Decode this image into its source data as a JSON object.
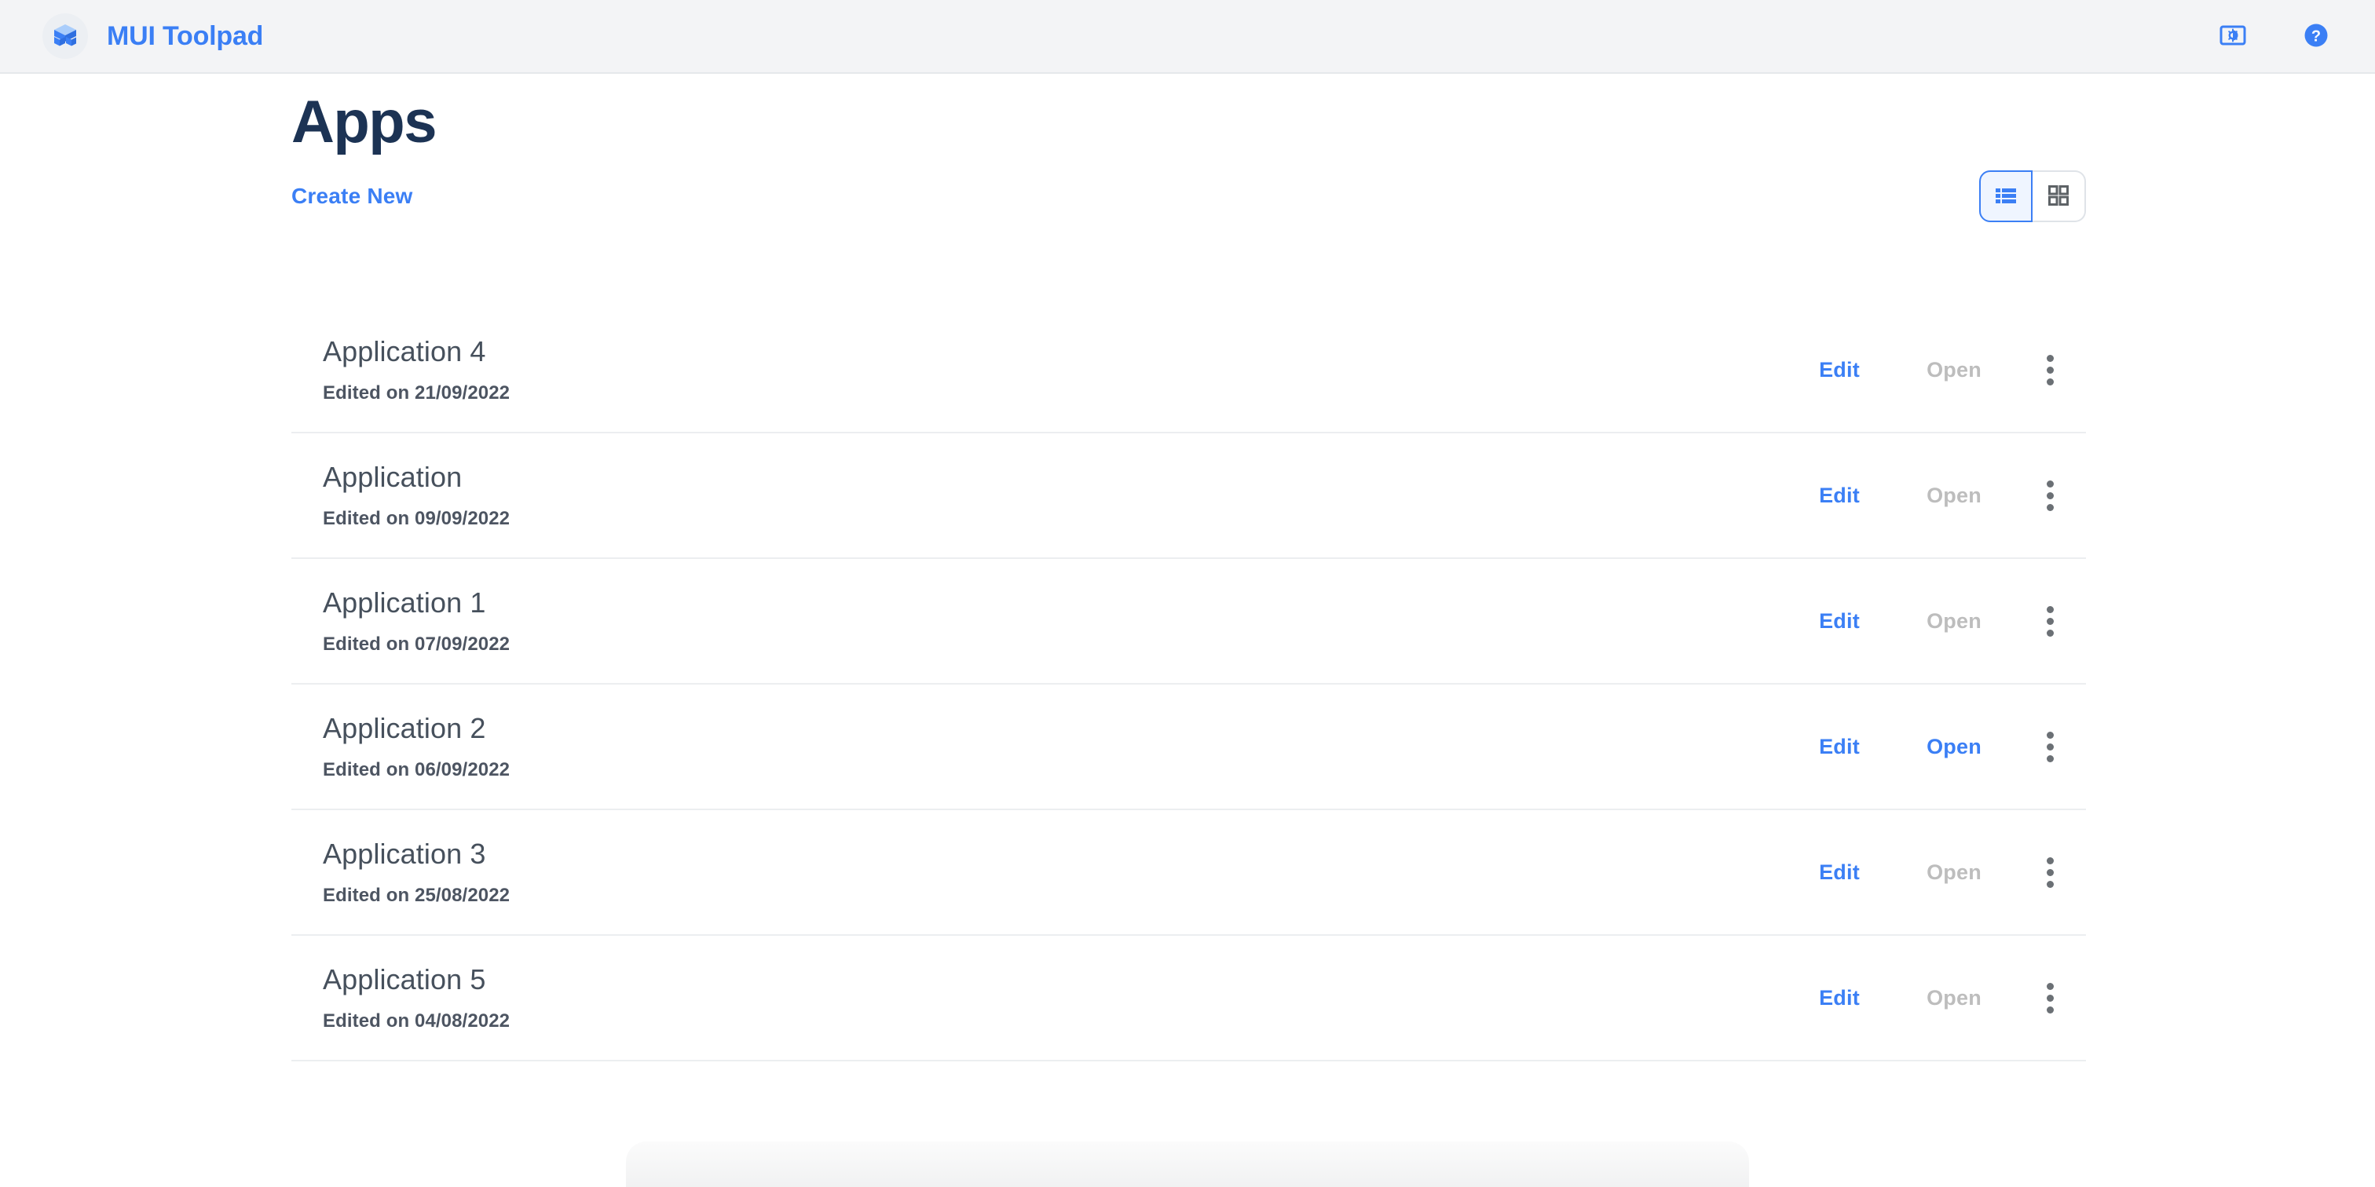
{
  "appbar": {
    "logo_icon": "toolpad-blocks-logo-icon",
    "brand": "MUI Toolpad",
    "actions": [
      {
        "icon": "brightness-theme-icon",
        "label": "Toggle theme"
      },
      {
        "icon": "help-circle-icon",
        "label": "Help"
      }
    ]
  },
  "page": {
    "title": "Apps",
    "create_new_label": "Create New"
  },
  "view_toggle": {
    "options": [
      {
        "icon": "list-view-icon",
        "label": "List view",
        "active": true
      },
      {
        "icon": "grid-view-icon",
        "label": "Grid view",
        "active": false
      }
    ]
  },
  "row_actions": {
    "edit_label": "Edit",
    "open_label": "Open",
    "more_icon": "more-vertical-icon"
  },
  "apps": [
    {
      "name": "Application 4",
      "edited": "Edited on 21/09/2022",
      "open_enabled": false
    },
    {
      "name": "Application",
      "edited": "Edited on 09/09/2022",
      "open_enabled": false
    },
    {
      "name": "Application 1",
      "edited": "Edited on 07/09/2022",
      "open_enabled": false
    },
    {
      "name": "Application 2",
      "edited": "Edited on 06/09/2022",
      "open_enabled": true
    },
    {
      "name": "Application 3",
      "edited": "Edited on 25/08/2022",
      "open_enabled": false
    },
    {
      "name": "Application 5",
      "edited": "Edited on 04/08/2022",
      "open_enabled": false
    }
  ],
  "colors": {
    "brand_blue": "#3b7ff5",
    "title_navy": "#1c3354",
    "text_gray": "#46505c",
    "disabled_gray": "#bdbdbd",
    "appbar_bg": "#f3f4f6",
    "divider": "#eceef0",
    "active_toggle_bg": "#eff5ff"
  }
}
